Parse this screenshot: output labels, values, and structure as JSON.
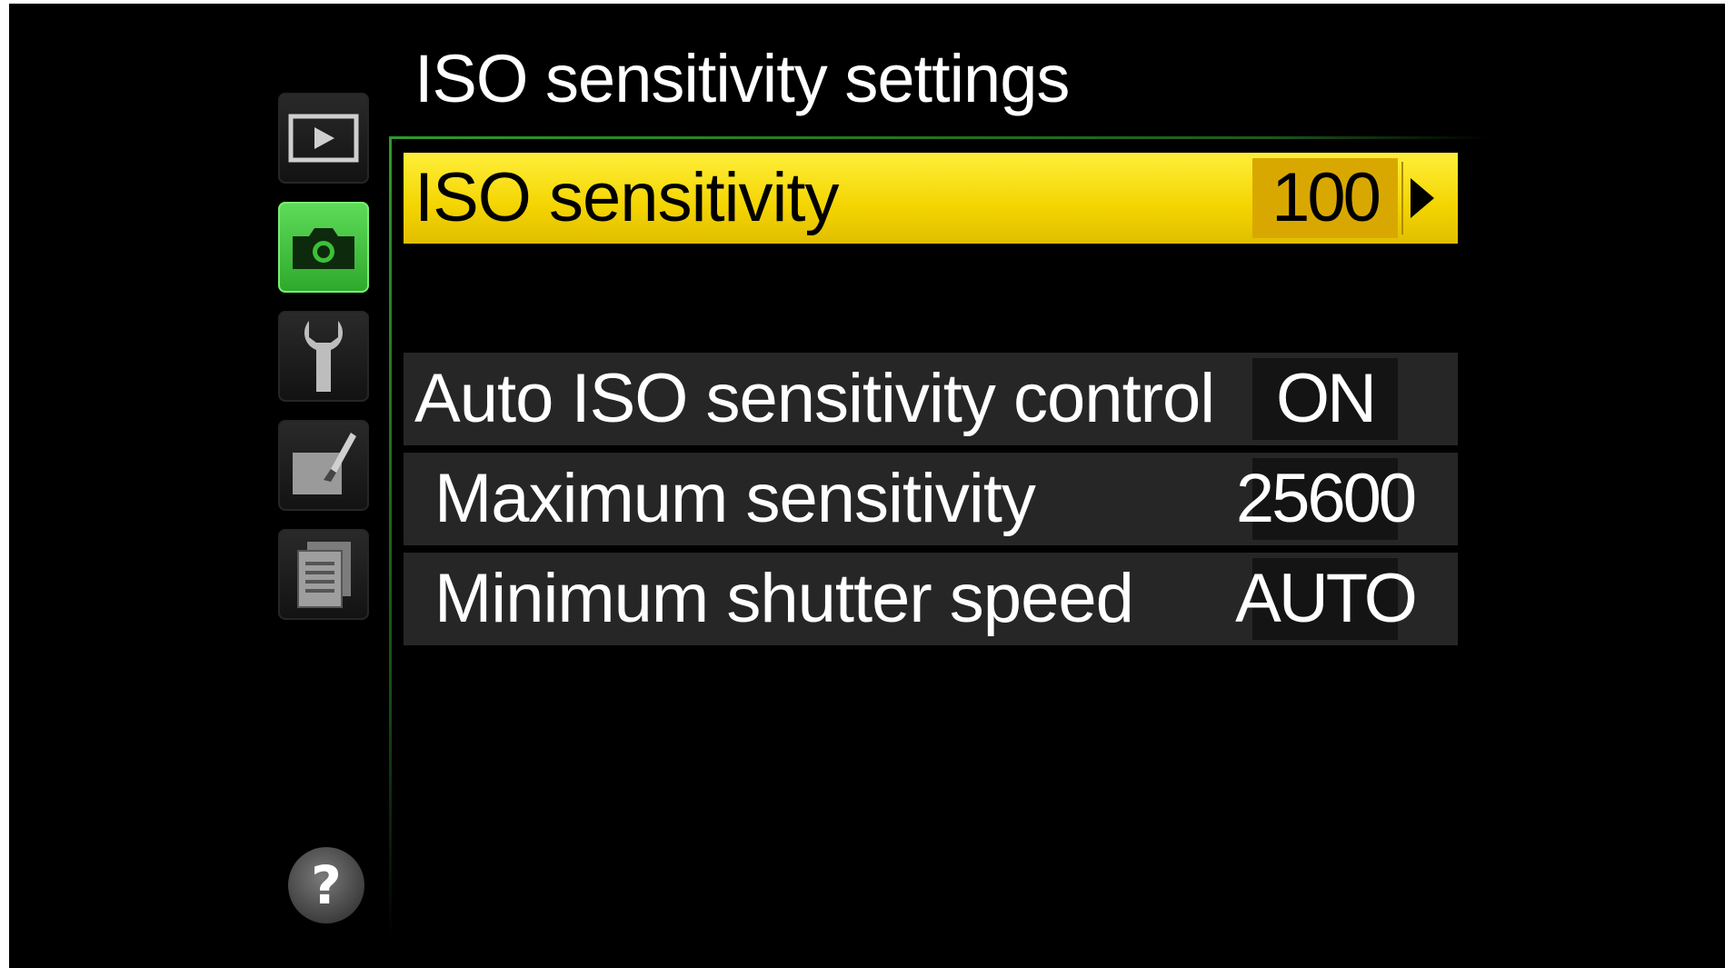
{
  "menu": {
    "title": "ISO sensitivity settings",
    "tabs": [
      {
        "name": "playback-menu",
        "icon": "playback-icon"
      },
      {
        "name": "shooting-menu",
        "icon": "camera-icon",
        "active": true
      },
      {
        "name": "setup-menu",
        "icon": "wrench-icon"
      },
      {
        "name": "retouch-menu",
        "icon": "retouch-brush-icon"
      },
      {
        "name": "recent-settings-menu",
        "icon": "recent-settings-icon"
      }
    ],
    "help_label": "?",
    "items": [
      {
        "label": "ISO sensitivity",
        "value": "100",
        "selected": true
      },
      {
        "label": "Auto ISO sensitivity control",
        "value": "ON"
      },
      {
        "label": "Maximum sensitivity",
        "value": "25600"
      },
      {
        "label": "Minimum shutter speed",
        "value": "AUTO"
      }
    ]
  },
  "colors": {
    "highlight": "#f3d400",
    "highlight_value_bg": "#d9a800",
    "active_tab": "#3cc038",
    "frame_line": "#2f9a2a",
    "row_bg": "#262626",
    "background": "#000000"
  }
}
